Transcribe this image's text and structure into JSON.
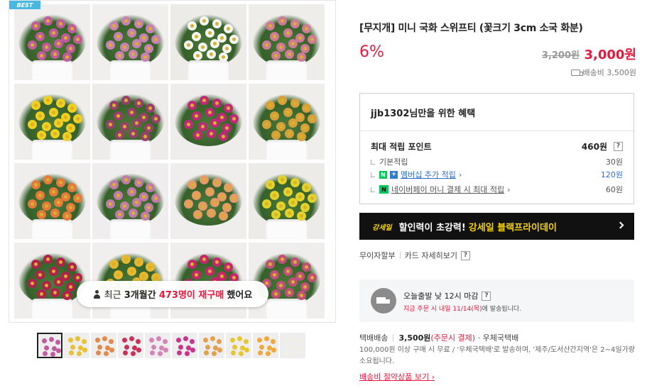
{
  "gallery": {
    "badge": "BEST",
    "tiles": [
      {
        "bloom": "#c45a9e",
        "bg": "#efeeed"
      },
      {
        "bloom": "#c980b6",
        "bg": "#f1efee"
      },
      {
        "bloom": "#f4f4f2",
        "bg": "#ecebe8"
      },
      {
        "bloom": "#d07a9a",
        "bg": "#eeedea"
      },
      {
        "bloom": "#f1cf1d",
        "bg": "#efeeeb"
      },
      {
        "bloom": "#9a3f6c",
        "bg": "#eeeceb"
      },
      {
        "bloom": "#c1287a",
        "bg": "#efedec"
      },
      {
        "bloom": "#d8a03a",
        "bg": "#efeeeb"
      },
      {
        "bloom": "#e67a3c",
        "bg": "#f0eeec"
      },
      {
        "bloom": "#c27aab",
        "bg": "#efeded"
      },
      {
        "bloom": "#e69a6a",
        "bg": "#efeeec"
      },
      {
        "bloom": "#e2d22a",
        "bg": "#ecebe8"
      },
      {
        "bloom": "#b3204e",
        "bg": "#efeeed"
      },
      {
        "bloom": "#e7b72c",
        "bg": "#f0efed"
      },
      {
        "bloom": "#c9246d",
        "bg": "#efeeed"
      },
      {
        "bloom": "#c24f7a",
        "bg": "#efeeec"
      }
    ],
    "repurchase": {
      "prefix": "최근",
      "period": "3개월간",
      "count": "473명이 재구매",
      "suffix": "했어요"
    },
    "thumbs": [
      {
        "bloom": "#c45a9e"
      },
      {
        "bloom": "#e9c132"
      },
      {
        "bloom": "#e28a4a"
      },
      {
        "bloom": "#cb3059"
      },
      {
        "bloom": "#d684b6"
      },
      {
        "bloom": "#c8358a"
      },
      {
        "bloom": "#e3a04c"
      },
      {
        "bloom": "#e7c730"
      },
      {
        "bloom": "#f2a83a"
      },
      {
        "bloom": "#f1efe6"
      }
    ]
  },
  "product": {
    "title": "[무지개] 미니 국화 스위프티 (꽃크기 3cm 소국 화분)",
    "discount": "6%",
    "original_price": "3,200원",
    "sale_price": "3,000원",
    "shipping_fee": "배송비 3,500원"
  },
  "benefits": {
    "heading": "jjb1302님만을 위한 혜택",
    "max_points_label": "최대 적립 포인트",
    "max_points_value": "460원",
    "rows": [
      {
        "label": "기본적립",
        "value": "30원"
      },
      {
        "label": "멤버십 추가 적립",
        "value": "120원"
      },
      {
        "label": "네이버페이 머니 결제 시 최대 적립",
        "value": "60원"
      }
    ]
  },
  "promo": {
    "logo": "강세일",
    "text1": "할인력이 초강력!",
    "text2": "강세일 블랙프라이데이"
  },
  "installment": {
    "label1": "무이자할부",
    "label2": "카드 자세히보기"
  },
  "shipping": {
    "line1": "오늘출발 낮 12시 마감",
    "line2_red": "지금 주문 시 내일 11/14(목)",
    "line2_rest": "에 발송됩니다."
  },
  "delivery": {
    "type": "택배배송",
    "price": "3,500원",
    "condition": "(주문시 결제)",
    "carrier": "· 우체국택배",
    "desc": "100,000원 이상 구매 시 무료 / '우체국택배'로 발송하며, '제주/도서산간지역'은 2~4일가량 소요됩니다.",
    "link": "배송비 절약상품 보기"
  },
  "colors": {
    "accent_red": "#e4193e",
    "link_blue": "#2e6cc9",
    "naver_green": "#03c75a",
    "promo_yellow": "#f5d300"
  }
}
